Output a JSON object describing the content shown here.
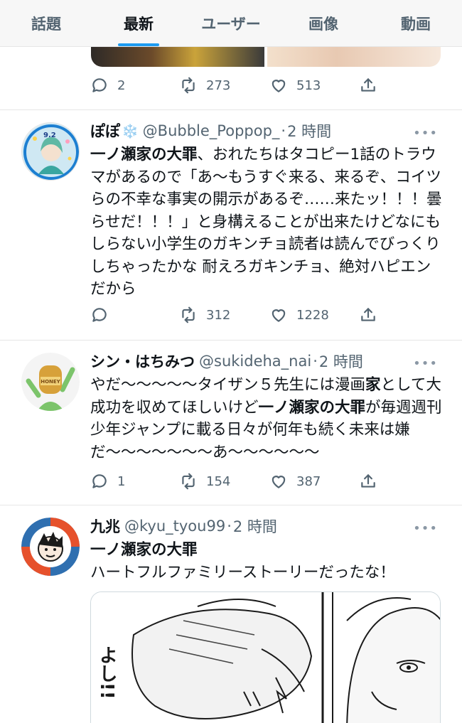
{
  "tabs": [
    {
      "label": "話題",
      "active": false
    },
    {
      "label": "最新",
      "active": true
    },
    {
      "label": "ユーザー",
      "active": false
    },
    {
      "label": "画像",
      "active": false
    },
    {
      "label": "動画",
      "active": false
    }
  ],
  "prev_tweet": {
    "replies": "2",
    "retweets": "273",
    "likes": "513"
  },
  "tweets": [
    {
      "name": "ぽぽ",
      "name_emoji": "❄️",
      "handle": "@Bubble_Poppop_",
      "dot": "·",
      "time": "2 時間",
      "text_bold": "一ノ瀬家の大罪",
      "text_rest": "、おれたちはタコピー1話のトラウマがあるので「あ〜もうすぐ来る、来るぞ、コイツらの不幸な事実の開示があるぞ……来たッ！！！曇らせだ！！！」と身構えることが出来たけどなにもしらない小学生のガキンチョ読者は読んでびっくりしちゃったかな 耐えろガキンチョ、絶対ハピエンだから",
      "replies": "",
      "retweets": "312",
      "likes": "1228",
      "avatar_text": "9.2"
    },
    {
      "name": "シン・はちみつ",
      "handle": "@sukideha_nai",
      "dot": "·",
      "time": "2 時間",
      "text_a": "やだ〜〜〜〜〜タイザン５先生には漫画",
      "text_b": "家",
      "text_c": "として大成功を収めてほしいけど",
      "text_d": "一ノ瀬家の大罪",
      "text_e": "が毎週週刊少年ジャンプに載る日々が何年も続く未来は嫌だ〜〜〜〜〜〜〜あ〜〜〜〜〜〜",
      "replies": "1",
      "retweets": "154",
      "likes": "387",
      "avatar_text": "HONEY"
    },
    {
      "name": "九兆",
      "handle": "@kyu_tyou99",
      "dot": "·",
      "time": "2 時間",
      "text_bold": "一ノ瀬家の大罪",
      "text_rest": "ハートフルファミリーストーリーだったな！",
      "manga_sfx": "よし!!"
    }
  ],
  "more_label": "•••",
  "colors": {
    "accent": "#1d9bf0",
    "muted": "#536471",
    "text": "#0f1419"
  }
}
